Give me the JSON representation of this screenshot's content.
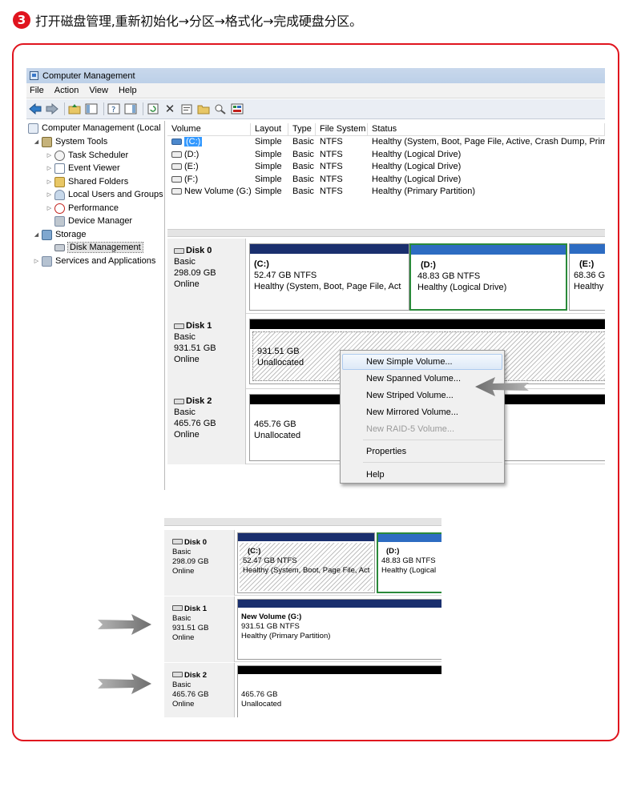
{
  "step": {
    "number": "3",
    "text": "打开磁盘管理,重新初始化→分区→格式化→完成硬盘分区。"
  },
  "window": {
    "title": "Computer Management"
  },
  "menu": [
    "File",
    "Action",
    "View",
    "Help"
  ],
  "tree": {
    "root": "Computer Management (Local",
    "system_tools": "System Tools",
    "task_scheduler": "Task Scheduler",
    "event_viewer": "Event Viewer",
    "shared_folders": "Shared Folders",
    "local_users": "Local Users and Groups",
    "performance": "Performance",
    "device_manager": "Device Manager",
    "storage": "Storage",
    "disk_management": "Disk Management",
    "services": "Services and Applications"
  },
  "volume_table": {
    "headers": [
      "Volume",
      "Layout",
      "Type",
      "File System",
      "Status"
    ],
    "rows": [
      [
        "(C:)",
        "Simple",
        "Basic",
        "NTFS",
        "Healthy (System, Boot, Page File, Active, Crash Dump, Prima"
      ],
      [
        "(D:)",
        "Simple",
        "Basic",
        "NTFS",
        "Healthy (Logical Drive)"
      ],
      [
        "(E:)",
        "Simple",
        "Basic",
        "NTFS",
        "Healthy (Logical Drive)"
      ],
      [
        "(F:)",
        "Simple",
        "Basic",
        "NTFS",
        "Healthy (Logical Drive)"
      ],
      [
        "New Volume (G:)",
        "Simple",
        "Basic",
        "NTFS",
        "Healthy (Primary Partition)"
      ]
    ]
  },
  "disks": {
    "disk0": {
      "name": "Disk 0",
      "type": "Basic",
      "size": "298.09 GB",
      "status": "Online"
    },
    "disk1": {
      "name": "Disk 1",
      "type": "Basic",
      "size": "931.51 GB",
      "status": "Online"
    },
    "disk2": {
      "name": "Disk 2",
      "type": "Basic",
      "size": "465.76 GB",
      "status": "Online"
    }
  },
  "partitions": {
    "c": {
      "name": "(C:)",
      "size": "52.47 GB NTFS",
      "status": "Healthy (System, Boot, Page File, Act"
    },
    "d": {
      "name": "(D:)",
      "size": "48.83 GB NTFS",
      "status": "Healthy (Logical Drive)"
    },
    "e": {
      "name": "(E:)",
      "size": "68.36 GI",
      "status": "Healthy"
    },
    "disk1_unalloc": {
      "size": "931.51 GB",
      "status": "Unallocated"
    },
    "disk2_unalloc": {
      "size": "465.76 GB",
      "status": "Unallocated"
    }
  },
  "context_menu": {
    "new_simple": "New Simple Volume...",
    "new_spanned": "New Spanned Volume...",
    "new_striped": "New Striped Volume...",
    "new_mirrored": "New Mirrored Volume...",
    "new_raid5": "New RAID-5 Volume...",
    "properties": "Properties",
    "help": "Help"
  },
  "result": {
    "disk0": {
      "name": "Disk 0",
      "type": "Basic",
      "size": "298.09 GB",
      "status": "Online"
    },
    "disk1": {
      "name": "Disk 1",
      "type": "Basic",
      "size": "931.51 GB",
      "status": "Online"
    },
    "disk2": {
      "name": "Disk 2",
      "type": "Basic",
      "size": "465.76 GB",
      "status": "Online"
    },
    "c": {
      "name": "(C:)",
      "size": "52.47 GB NTFS",
      "status": "Healthy (System, Boot, Page File, Act"
    },
    "d": {
      "name": "(D:)",
      "size": "48.83 GB NTFS",
      "status": "Healthy (Logical"
    },
    "g": {
      "name": "New Volume  (G:)",
      "size": "931.51 GB NTFS",
      "status": "Healthy (Primary Partition)"
    },
    "disk2_unalloc": {
      "size": "465.76 GB",
      "status": "Unallocated"
    }
  },
  "colors": {
    "accent_red": "#e0141e",
    "primary_bar": "#1a2f6e",
    "logical_bar": "#2d6cc2",
    "unallocated_bar": "#000000",
    "selection_green": "#2a8a3a"
  }
}
